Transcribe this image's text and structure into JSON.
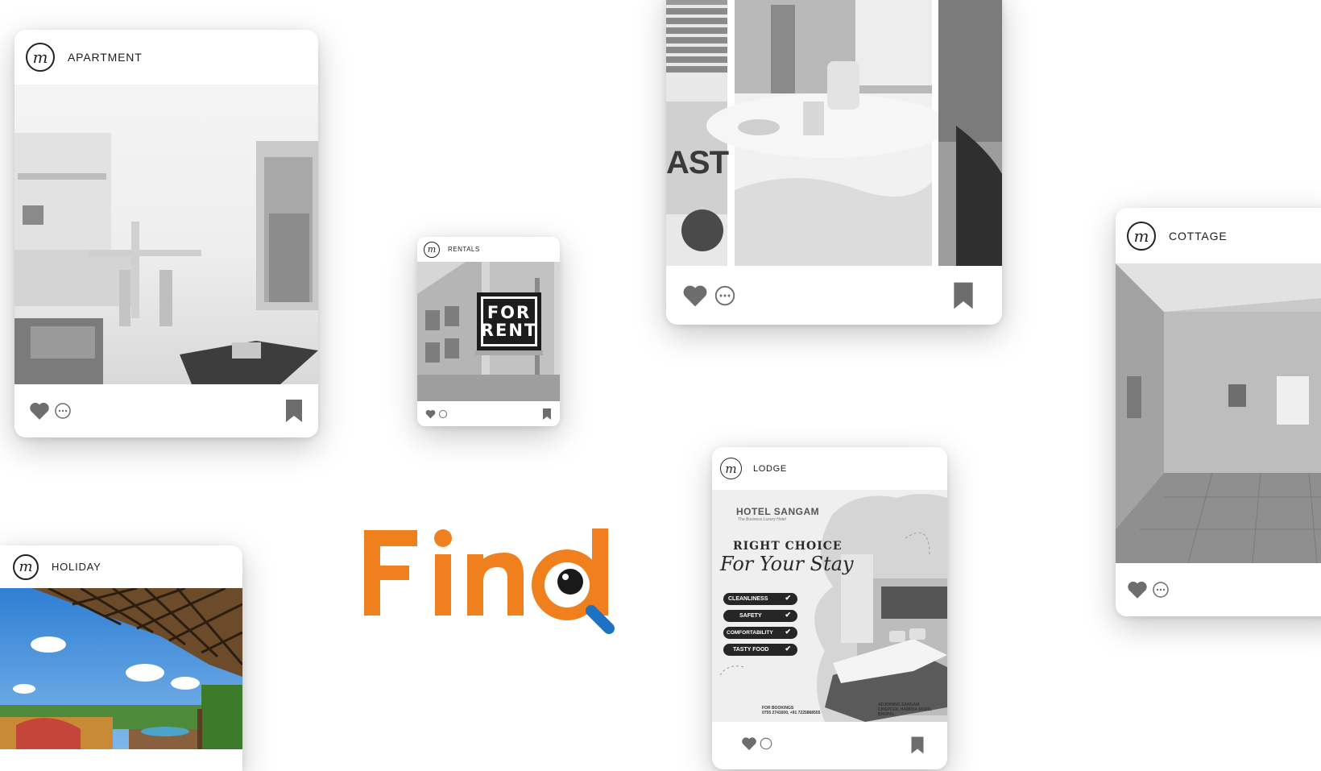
{
  "brand": {
    "word": "Find",
    "color_orange": "#F07F1E",
    "color_blue": "#1E72C4"
  },
  "cards": {
    "apartment": {
      "label": "APARTMENT",
      "logo_icon": "logo-m-icon"
    },
    "rentals": {
      "label": "RENTALS",
      "sign_line1": "FOR",
      "sign_line2": "RENT"
    },
    "breakfast": {
      "sign_text": "AST"
    },
    "cottage": {
      "label": "COTTAGE"
    },
    "lodge": {
      "label": "LODGE",
      "hotel_name": "HOTEL SANGAM",
      "hotel_tagline": "The Business Luxury Hotel",
      "headline": "RIGHT CHOICE",
      "script_line": "For Your Stay",
      "features": [
        "CLEANLINESS",
        "SAFETY",
        "COMFORTABILITY",
        "TASTY FOOD"
      ],
      "bookings_label": "FOR BOOKINGS",
      "bookings_phone": "0755 2741600, +91 7225868555",
      "address_line1": "ADJOINING SANGAM",
      "address_line2": "CINEPLEX, HAMIDIA ROAD,",
      "address_line3": "BHOPAL"
    },
    "holiday": {
      "label": "HOLIDAY"
    }
  },
  "icons": {
    "heart": "heart-icon",
    "comment": "comment-icon",
    "bookmark": "bookmark-icon",
    "magnifier": "magnifier-icon"
  }
}
